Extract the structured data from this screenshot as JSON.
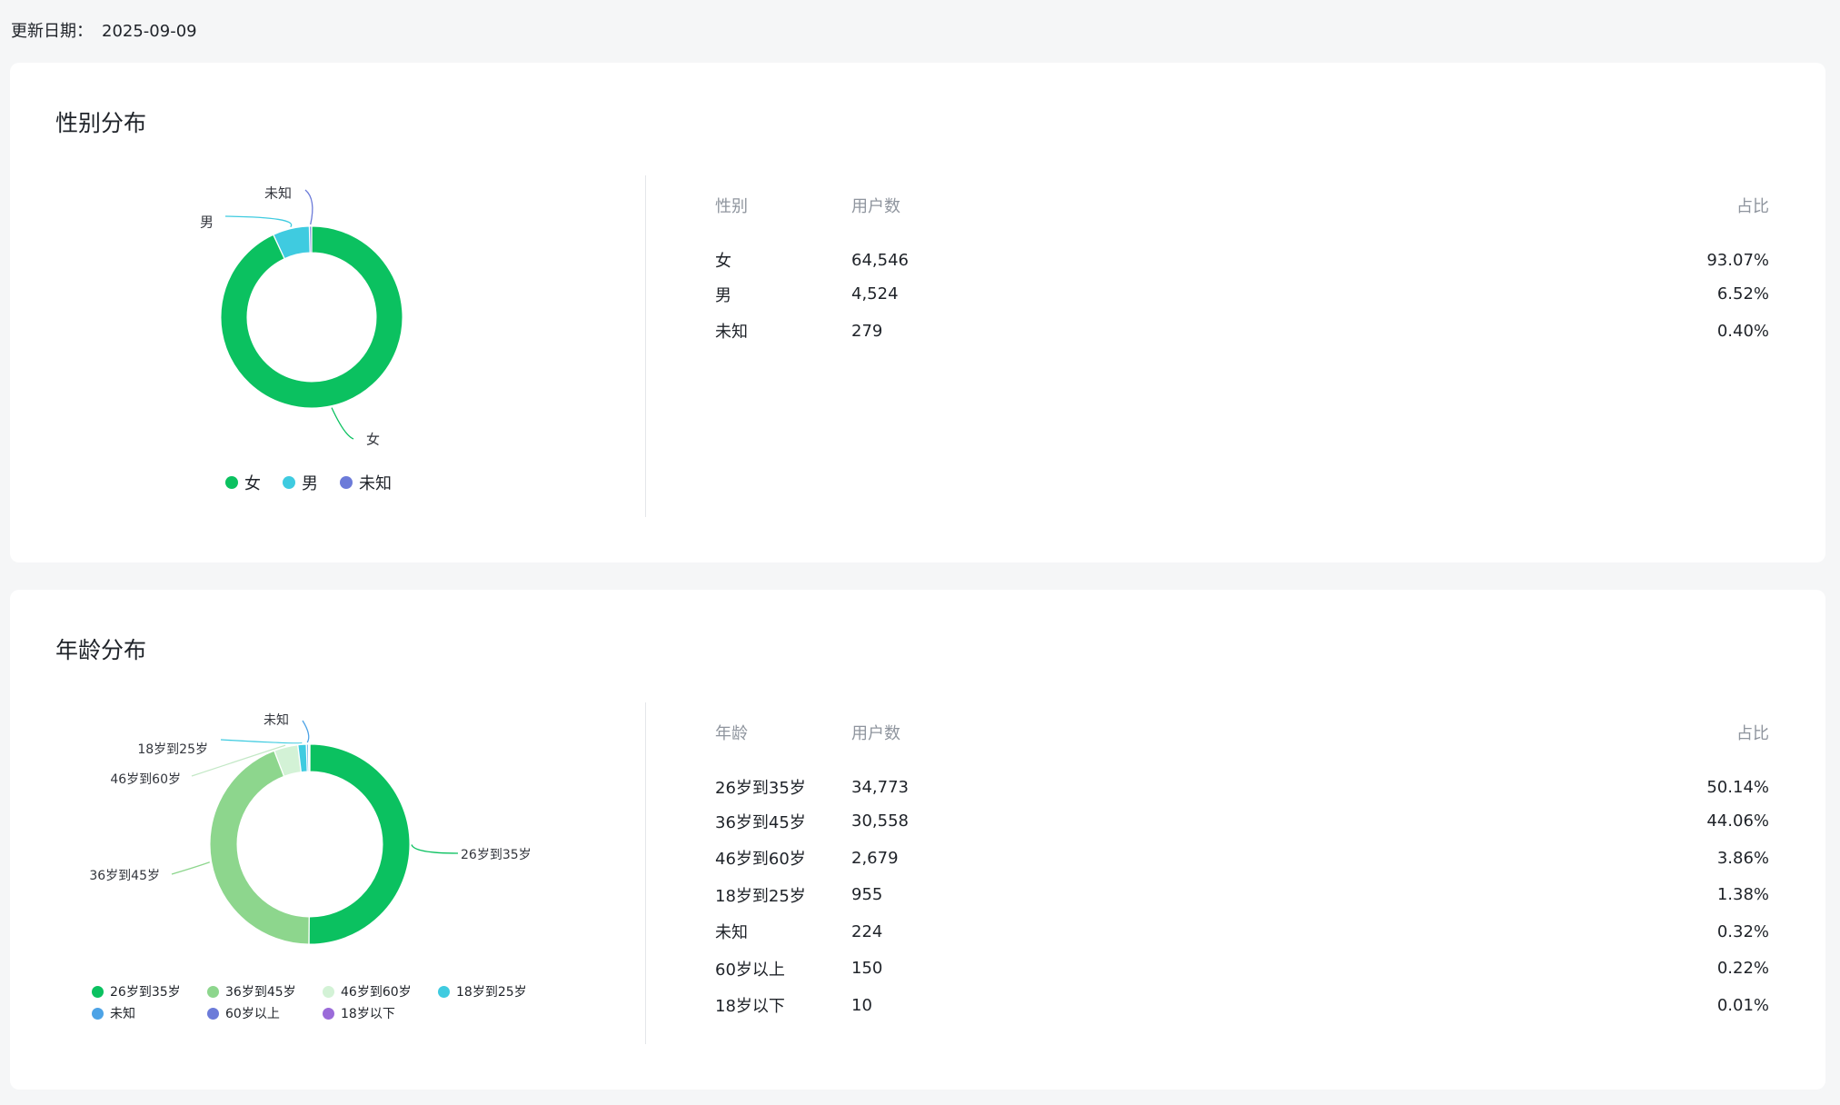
{
  "update": {
    "label": "更新日期：",
    "date": "2025-09-09"
  },
  "gender": {
    "title": "性别分布",
    "table": {
      "headers": [
        "性别",
        "用户数",
        "占比"
      ],
      "rows": [
        [
          "女",
          "64,546",
          "93.07%"
        ],
        [
          "男",
          "4,524",
          "6.52%"
        ],
        [
          "未知",
          "279",
          "0.40%"
        ]
      ]
    }
  },
  "age": {
    "title": "年龄分布",
    "table": {
      "headers": [
        "年龄",
        "用户数",
        "占比"
      ],
      "rows": [
        [
          "26岁到35岁",
          "34,773",
          "50.14%"
        ],
        [
          "36岁到45岁",
          "30,558",
          "44.06%"
        ],
        [
          "46岁到60岁",
          "2,679",
          "3.86%"
        ],
        [
          "18岁到25岁",
          "955",
          "1.38%"
        ],
        [
          "未知",
          "224",
          "0.32%"
        ],
        [
          "60岁以上",
          "150",
          "0.22%"
        ],
        [
          "18岁以下",
          "10",
          "0.01%"
        ]
      ]
    }
  },
  "chart_data": [
    {
      "type": "pie",
      "style": "donut",
      "categories": [
        "女",
        "男",
        "未知"
      ],
      "values": [
        64546,
        4524,
        279
      ],
      "colors": [
        "#0bc160",
        "#3fcbe0",
        "#6c7bd9"
      ],
      "legend": "bottom",
      "slice_labels": true
    },
    {
      "type": "pie",
      "style": "donut",
      "categories": [
        "26岁到35岁",
        "36岁到45岁",
        "46岁到60岁",
        "18岁到25岁",
        "未知",
        "60岁以上",
        "18岁以下"
      ],
      "values": [
        34773,
        30558,
        2679,
        955,
        224,
        150,
        10
      ],
      "colors": [
        "#0bc160",
        "#8dd68d",
        "#d3f2d6",
        "#3fcbe0",
        "#4da3e6",
        "#6c7bd9",
        "#9b6bd9"
      ],
      "legend": "bottom",
      "slice_labels": true
    }
  ]
}
